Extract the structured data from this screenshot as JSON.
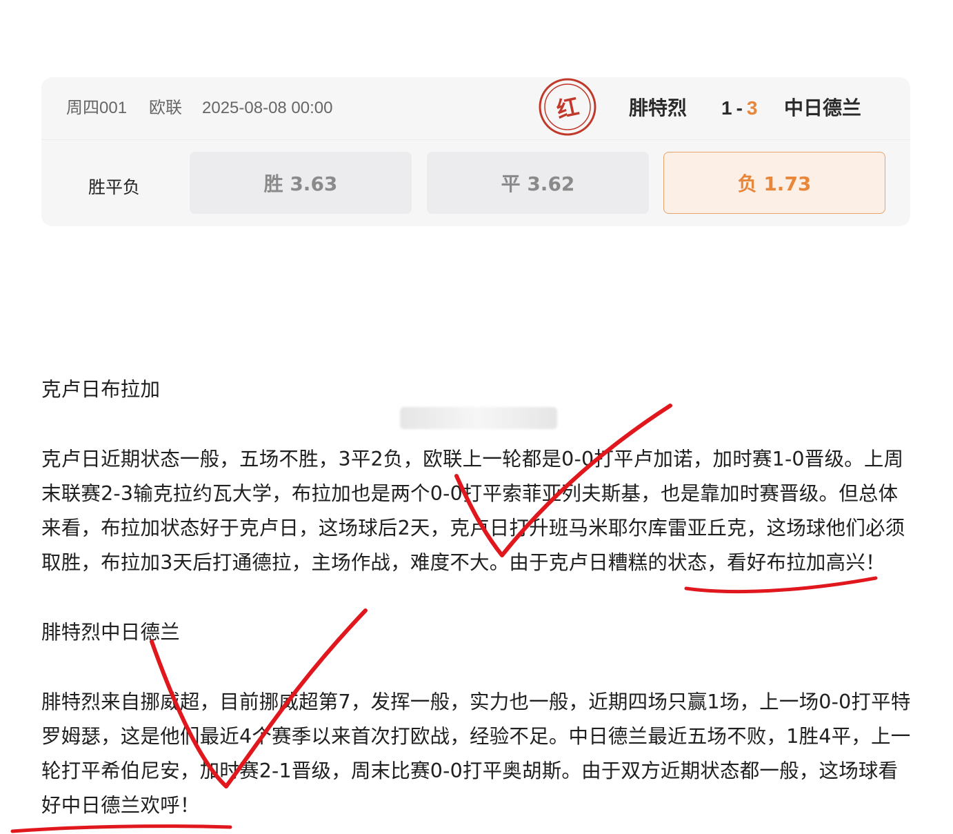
{
  "match": {
    "code": "周四001",
    "league": "欧联",
    "datetime": "2025-08-08 00:00",
    "result_seal": "红",
    "home_team": "腓特烈",
    "home_score": "1",
    "score_separator": "-",
    "away_score": "3",
    "away_team": "中日德兰"
  },
  "odds": {
    "label": "胜平负",
    "items": [
      {
        "label": "胜 3.63",
        "selected": false
      },
      {
        "label": "平 3.62",
        "selected": false
      },
      {
        "label": "负 1.73",
        "selected": true
      }
    ]
  },
  "article": {
    "sections": [
      {
        "heading": "克卢日布拉加",
        "lines": [
          "克卢日近期状态一般，五场不胜，3平2负，欧联上一轮都是0-0打平卢加诺，加时赛1-0晋级。上周",
          "末联赛2-3输克拉约瓦大学，布拉加也是两个0-0打平索菲亚列夫斯基，也是靠加时赛晋级。但总体",
          "来看，布拉加状态好于克卢日，这场球后2天，克卢日打升班马米耶尔库雷亚丘克，这场球他们必须",
          "取胜，布拉加3天后打通德拉，主场作战，难度不大。由于克卢日糟糕的状态，看好布拉加高兴！"
        ]
      },
      {
        "heading": "腓特烈中日德兰",
        "lines": [
          "腓特烈来自挪威超，目前挪威超第7，发挥一般，实力也一般，近期四场只赢1场，上一场0-0打平特",
          "罗姆瑟，这是他们最近4个赛季以来首次打欧战，经验不足。中日德兰最近五场不败，1胜4平，上一",
          "轮打平希伯尼安，加时赛2-1晋级，周末比赛0-0打平奥胡斯。由于双方近期状态都一般，这场球看",
          "好中日德兰欢呼！"
        ]
      }
    ]
  },
  "colors": {
    "accent_orange": "#e8863a",
    "seal_red": "#c0392b",
    "annotation_red": "#e0181e"
  }
}
